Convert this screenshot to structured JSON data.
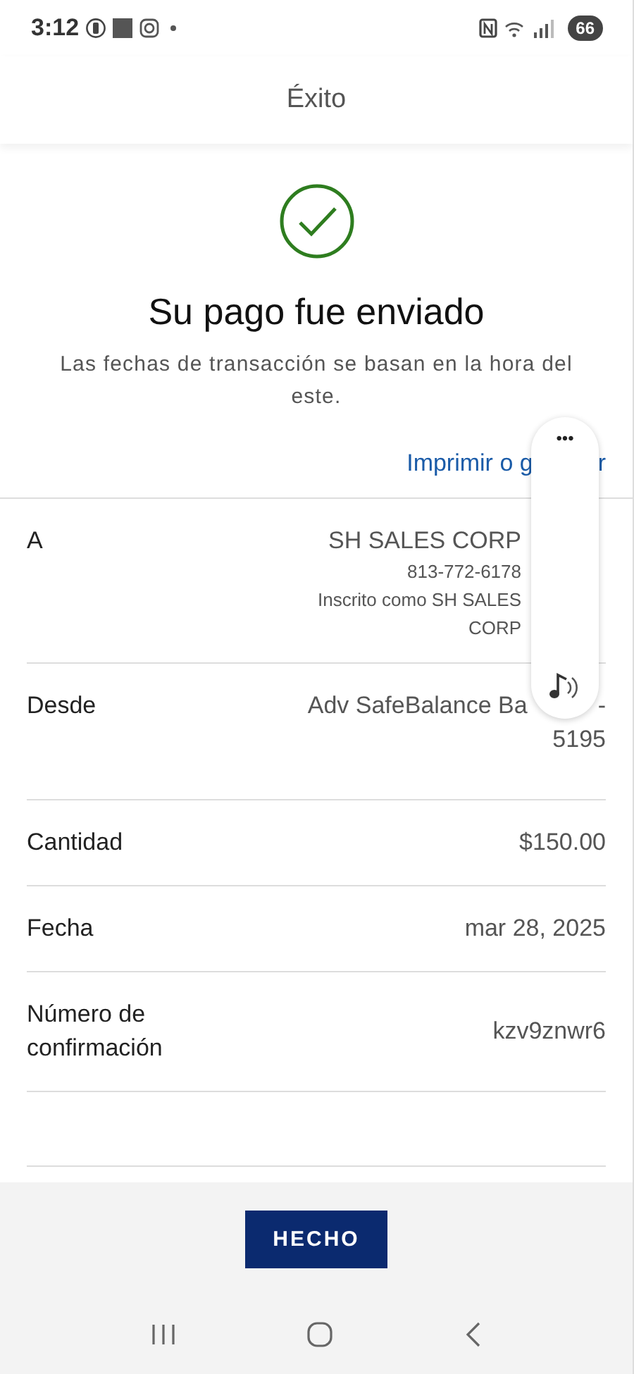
{
  "status_bar": {
    "time": "3:12",
    "battery": "66"
  },
  "header": {
    "title": "Éxito"
  },
  "result": {
    "title": "Su pago fue enviado",
    "note": "Las fechas de transacción se basan en la hora del este."
  },
  "print_link": {
    "text_before": "Imprimir o g",
    "text_after": "r"
  },
  "details": [
    {
      "label": "A",
      "lines": [
        "SH SALES CORP",
        "813-772-6178",
        "Inscrito como SH SALES CORP"
      ],
      "kind": "payee"
    },
    {
      "label": "Desde",
      "lines": [
        "Adv SafeBalance Ba",
        "-",
        "5195"
      ],
      "kind": "account"
    },
    {
      "label": "Cantidad",
      "lines": [
        "$150.00"
      ],
      "kind": "plain"
    },
    {
      "label": "Fecha",
      "lines": [
        "mar 28, 2025"
      ],
      "kind": "plain"
    },
    {
      "label": "Número de confirmación",
      "lines": [
        "kzv9znwr6"
      ],
      "kind": "plain"
    }
  ],
  "floating_panel": {
    "menu": "•••"
  },
  "done_button": {
    "label": "HECHO"
  }
}
